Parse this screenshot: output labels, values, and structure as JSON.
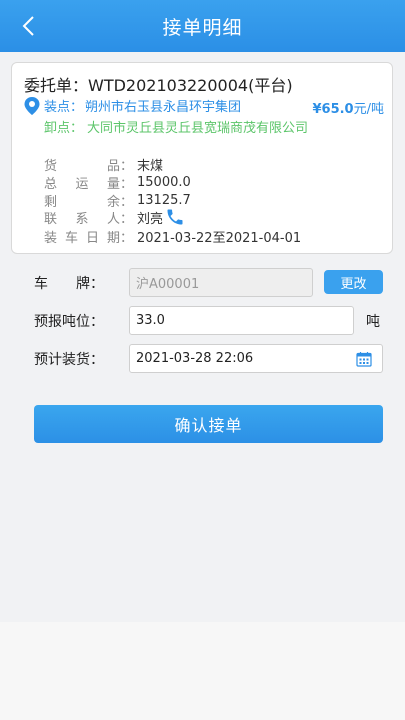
{
  "header": {
    "title": "接单明细"
  },
  "order": {
    "title": "委托单：WTD202103220004(平台)",
    "load_label": "装点：",
    "load_address": "朔州市右玉县永昌环宇集团",
    "price": "¥65.0",
    "price_unit": "元/吨",
    "unload_label": "卸点：",
    "unload_address": "大同市灵丘县灵丘县宽瑞商茂有限公司",
    "fields": [
      {
        "label": [
          "货",
          "品"
        ],
        "value": "末煤"
      },
      {
        "label": [
          "总",
          "运",
          "量"
        ],
        "value": "15000.0"
      },
      {
        "label": [
          "剩",
          "余"
        ],
        "value": "13125.7"
      },
      {
        "label": [
          "联",
          "系",
          "人"
        ],
        "value": "刘亮"
      },
      {
        "label": [
          "装",
          "车",
          "日",
          "期"
        ],
        "value": "2021-03-22至2021-04-01"
      }
    ]
  },
  "form": {
    "plate_label": "车　　牌：",
    "plate_value": "沪A00001",
    "change_label": "更改",
    "tonnage_label": "预报吨位：",
    "tonnage_value": "33.0",
    "tonnage_unit": "吨",
    "time_label": "预计装货：",
    "time_value": "2021-03-28 22:06"
  },
  "actions": {
    "confirm_label": "确认接单"
  },
  "colors": {
    "primary": "#2d8fe6",
    "unload_green": "#5cc56a"
  },
  "icons": [
    "back-icon",
    "location-pin-icon",
    "phone-icon",
    "calendar-icon"
  ]
}
